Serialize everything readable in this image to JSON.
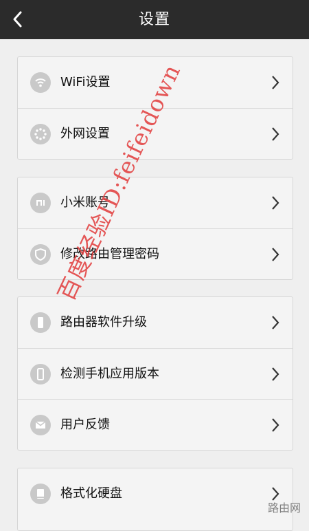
{
  "header": {
    "title": "设置"
  },
  "groups": [
    {
      "items": [
        {
          "label": "WiFi设置",
          "icon": "wifi-icon"
        },
        {
          "label": "外网设置",
          "icon": "spinner-icon"
        }
      ]
    },
    {
      "items": [
        {
          "label": "小米账号",
          "icon": "mi-account-icon"
        },
        {
          "label": "修改路由管理密码",
          "icon": "shield-icon"
        }
      ]
    },
    {
      "items": [
        {
          "label": "路由器软件升级",
          "icon": "phone-icon"
        },
        {
          "label": "检测手机应用版本",
          "icon": "phone-outline-icon"
        },
        {
          "label": "用户反馈",
          "icon": "mail-icon"
        }
      ]
    },
    {
      "items": [
        {
          "label": "格式化硬盘",
          "icon": "disk-icon"
        }
      ]
    }
  ],
  "watermark": {
    "text": "百度经验ID:feifeidown"
  },
  "logo": {
    "sub": "路由网"
  }
}
